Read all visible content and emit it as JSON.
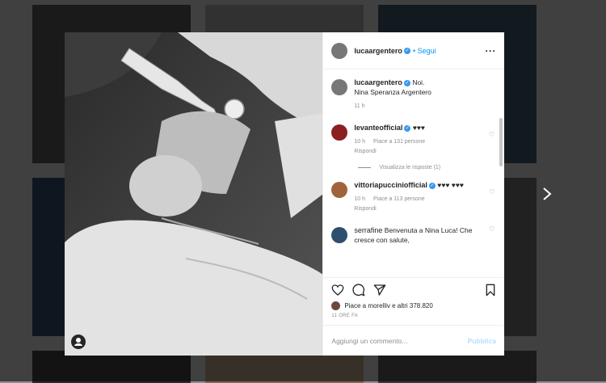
{
  "post": {
    "author": "lucaargentero",
    "follow_label": "Segui",
    "caption": "Noi.\nNina Speranza Argentero",
    "caption_time": "11 h"
  },
  "comments": [
    {
      "user": "levanteofficial",
      "text": "♥♥♥",
      "time": "10 h",
      "likes": "Piace a 131 persone",
      "reply_label": "Rispondi",
      "view_replies": "Visualizza le risposte (1)"
    },
    {
      "user": "vittoriapucciniofficial",
      "text": "♥♥♥ ♥♥♥",
      "time": "10 h",
      "likes": "Piace a 113 persone",
      "reply_label": "Rispondi"
    },
    {
      "user": "serrafine",
      "text": "Benvenuta a Nina Luca! Che cresce con salute,"
    }
  ],
  "likes_text": "Piace a morelliv e altri 378.820",
  "post_time": "11 ORE FA",
  "add_comment_placeholder": "Aggiungi un commento...",
  "publish_label": "Pubblica",
  "icons": {
    "like": "heart-icon",
    "comment": "comment-icon",
    "share": "paper-plane-icon",
    "save": "bookmark-icon",
    "more": "more-options-icon",
    "next": "chevron-right-icon",
    "tagged_user": "user-tag-icon"
  }
}
